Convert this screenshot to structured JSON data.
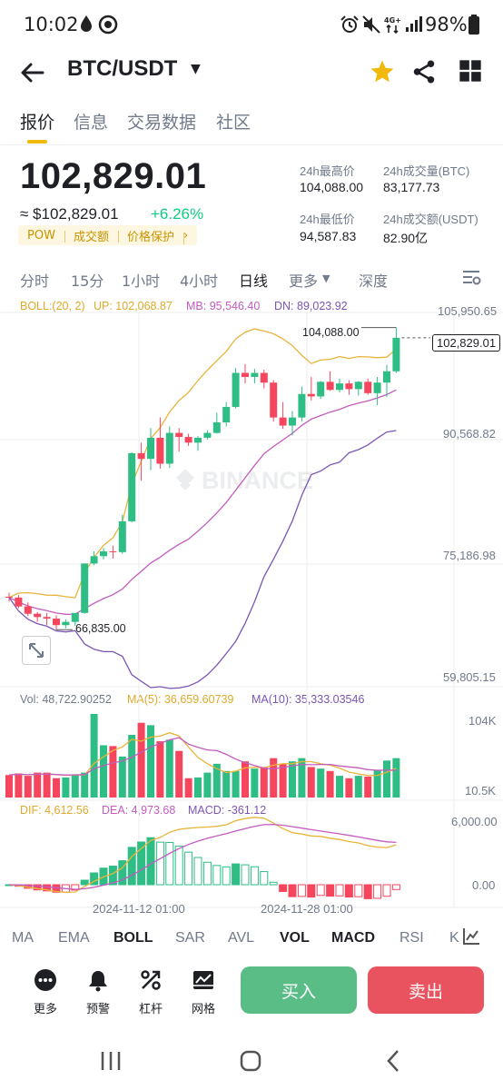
{
  "status_bar": {
    "time": "10:02",
    "battery": "98%"
  },
  "header": {
    "pair": "BTC/USDT",
    "starred": true
  },
  "tabs": [
    {
      "label": "报价",
      "active": true
    },
    {
      "label": "信息",
      "active": false
    },
    {
      "label": "交易数据",
      "active": false
    },
    {
      "label": "社区",
      "active": false
    }
  ],
  "ticker": {
    "last_price": "102,829.01",
    "fiat_price": "≈ $102,829.01",
    "change": "+6.26%",
    "tags": [
      "POW",
      "成交额",
      "价格保护"
    ],
    "high_label": "24h最高价",
    "high": "104,088.00",
    "vol_btc_label": "24h成交量(BTC)",
    "vol_btc": "83,177.73",
    "low_label": "24h最低价",
    "low": "94,587.83",
    "vol_usdt_label": "24h成交额(USDT)",
    "vol_usdt": "82.90亿"
  },
  "intervals": [
    {
      "label": "分时",
      "active": false
    },
    {
      "label": "15分",
      "active": false
    },
    {
      "label": "1小时",
      "active": false
    },
    {
      "label": "4小时",
      "active": false
    },
    {
      "label": "日线",
      "active": true
    },
    {
      "label": "更多",
      "active": false
    },
    {
      "label": "深度",
      "active": false
    }
  ],
  "indicators": {
    "boll": {
      "label": "BOLL:(20, 2)",
      "up": "UP: 102,068.87",
      "mb": "MB: 95,546.40",
      "dn": "DN: 89,023.92"
    },
    "vol": {
      "label": "Vol: 48,722.90252",
      "ma5": "MA(5): 36,659.60739",
      "ma10": "MA(10): 35,333.03546"
    },
    "macd": {
      "dif": "DIF: 4,612.56",
      "dea": "DEA: 4,973.68",
      "macd": "MACD: -361.12"
    }
  },
  "chart_data": {
    "type": "candlestick",
    "price_axis_ticks": [
      "105,950.65",
      "90,568.82",
      "75,186.98",
      "59,805.15"
    ],
    "price_range": [
      59805.15,
      105950.65
    ],
    "high_marker": "104,088.00",
    "low_marker": "66,835.00",
    "last_price_tag": "102,829.01",
    "last_price": 102829.01,
    "watermark": "BINANCE",
    "volume_axis_ticks": [
      "104K",
      "10.5K"
    ],
    "macd_axis_ticks": [
      "6,000.00",
      "0.00"
    ],
    "date_labels": [
      "2024-11-12 01:00",
      "2024-11-28 01:00"
    ],
    "candles": [
      {
        "o": 70900,
        "h": 71400,
        "l": 70300,
        "c": 70800
      },
      {
        "o": 70800,
        "h": 71100,
        "l": 69500,
        "c": 69700
      },
      {
        "o": 69700,
        "h": 70200,
        "l": 68500,
        "c": 68800
      },
      {
        "o": 68800,
        "h": 69000,
        "l": 67800,
        "c": 68400
      },
      {
        "o": 68400,
        "h": 68900,
        "l": 67400,
        "c": 68200
      },
      {
        "o": 68200,
        "h": 68600,
        "l": 66835,
        "c": 67400
      },
      {
        "o": 67400,
        "h": 68100,
        "l": 67000,
        "c": 67800
      },
      {
        "o": 67800,
        "h": 68400,
        "l": 67300,
        "c": 68900
      },
      {
        "o": 68900,
        "h": 75000,
        "l": 68800,
        "c": 75000
      },
      {
        "o": 75000,
        "h": 76500,
        "l": 74800,
        "c": 75900
      },
      {
        "o": 75900,
        "h": 76900,
        "l": 75500,
        "c": 76500
      },
      {
        "o": 76500,
        "h": 77200,
        "l": 75600,
        "c": 76400
      },
      {
        "o": 76400,
        "h": 81000,
        "l": 76200,
        "c": 80200
      },
      {
        "o": 80200,
        "h": 88700,
        "l": 80100,
        "c": 88600
      },
      {
        "o": 88600,
        "h": 89900,
        "l": 85200,
        "c": 87900
      },
      {
        "o": 87900,
        "h": 91700,
        "l": 86500,
        "c": 90500
      },
      {
        "o": 90500,
        "h": 93000,
        "l": 86700,
        "c": 87300
      },
      {
        "o": 87300,
        "h": 91900,
        "l": 86800,
        "c": 91100
      },
      {
        "o": 91100,
        "h": 91700,
        "l": 88800,
        "c": 90600
      },
      {
        "o": 90600,
        "h": 91000,
        "l": 89500,
        "c": 89900
      },
      {
        "o": 89900,
        "h": 90700,
        "l": 88900,
        "c": 90500
      },
      {
        "o": 90500,
        "h": 91400,
        "l": 90300,
        "c": 91100
      },
      {
        "o": 91100,
        "h": 93600,
        "l": 91000,
        "c": 92400
      },
      {
        "o": 92400,
        "h": 94900,
        "l": 91900,
        "c": 94300
      },
      {
        "o": 94300,
        "h": 99100,
        "l": 94100,
        "c": 98500
      },
      {
        "o": 98500,
        "h": 99600,
        "l": 97200,
        "c": 98000
      },
      {
        "o": 98000,
        "h": 99000,
        "l": 97200,
        "c": 98500
      },
      {
        "o": 98500,
        "h": 98900,
        "l": 96600,
        "c": 97300
      },
      {
        "o": 97300,
        "h": 97600,
        "l": 92500,
        "c": 93000
      },
      {
        "o": 93000,
        "h": 94900,
        "l": 91600,
        "c": 92000
      },
      {
        "o": 92000,
        "h": 93800,
        "l": 90800,
        "c": 93000
      },
      {
        "o": 93000,
        "h": 96800,
        "l": 92500,
        "c": 95900
      },
      {
        "o": 95900,
        "h": 98000,
        "l": 95100,
        "c": 95600
      },
      {
        "o": 95600,
        "h": 97500,
        "l": 95300,
        "c": 97400
      },
      {
        "o": 97400,
        "h": 98700,
        "l": 96300,
        "c": 96400
      },
      {
        "o": 96400,
        "h": 97800,
        "l": 96100,
        "c": 97200
      },
      {
        "o": 97200,
        "h": 97600,
        "l": 95800,
        "c": 96500
      },
      {
        "o": 96500,
        "h": 97500,
        "l": 95700,
        "c": 97400
      },
      {
        "o": 97400,
        "h": 97800,
        "l": 95800,
        "c": 96000
      },
      {
        "o": 96000,
        "h": 98000,
        "l": 94500,
        "c": 97300
      },
      {
        "o": 97300,
        "h": 99500,
        "l": 95500,
        "c": 98700
      },
      {
        "o": 98700,
        "h": 104088,
        "l": 98500,
        "c": 102829
      }
    ],
    "volumes": [
      28,
      30,
      27,
      31,
      31,
      24,
      25,
      29,
      31,
      104,
      65,
      64,
      51,
      78,
      93,
      90,
      70,
      72,
      58,
      24,
      25,
      31,
      42,
      33,
      33,
      45,
      36,
      38,
      49,
      42,
      45,
      49,
      38,
      36,
      33,
      27,
      24,
      27,
      26,
      34,
      46,
      49
    ]
  },
  "indicator_tabs": [
    {
      "label": "MA",
      "active": false
    },
    {
      "label": "EMA",
      "active": false
    },
    {
      "label": "BOLL",
      "active": true
    },
    {
      "label": "SAR",
      "active": false
    },
    {
      "label": "AVL",
      "active": false
    },
    {
      "label": "VOL",
      "active": true
    },
    {
      "label": "MACD",
      "active": true
    },
    {
      "label": "RSI",
      "active": false
    },
    {
      "label": "K",
      "active": false
    }
  ],
  "actions": {
    "more": "更多",
    "alert": "预警",
    "leverage": "杠杆",
    "grid": "网格",
    "buy": "买入",
    "sell": "卖出"
  },
  "colors": {
    "up": "#2ebd85",
    "down": "#f6465d",
    "accent": "#f0b90b",
    "boll_up": "#e8b43a",
    "boll_mb": "#c35bbf",
    "boll_dn": "#7b55b5",
    "buy_btn": "#5bbd86",
    "sell_btn": "#e9525f"
  }
}
